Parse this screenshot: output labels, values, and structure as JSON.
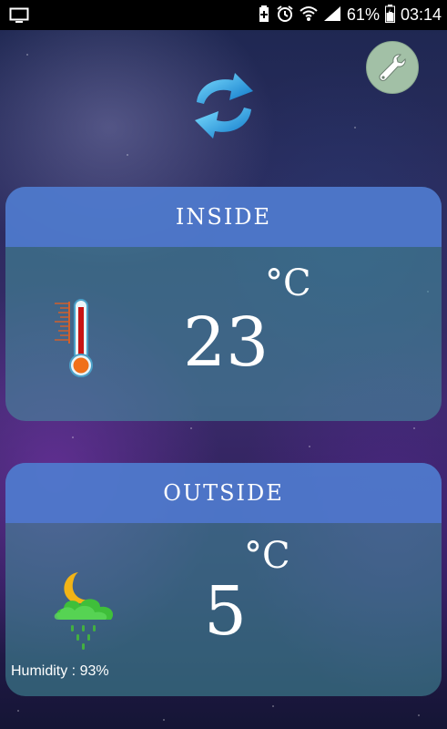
{
  "status_bar": {
    "battery_percent": "61%",
    "time": "03:14",
    "icons": [
      "screen-icon",
      "battery-saver-icon",
      "alarm-icon",
      "wifi-icon",
      "signal-icon",
      "battery-icon"
    ]
  },
  "toolbar": {
    "refresh_icon": "refresh-icon",
    "settings_icon": "wrench-icon"
  },
  "inside": {
    "title": "INSIDE",
    "temperature": "23",
    "unit": "°C",
    "icon": "thermometer-icon"
  },
  "outside": {
    "title": "OUTSIDE",
    "temperature": "5",
    "unit": "°C",
    "icon": "night-cloud-rain-icon",
    "humidity_text": "Humidity : 93%"
  },
  "colors": {
    "card_header": "#5078d2",
    "card_body": "#4696a0",
    "settings_button": "#a2c0a6"
  }
}
